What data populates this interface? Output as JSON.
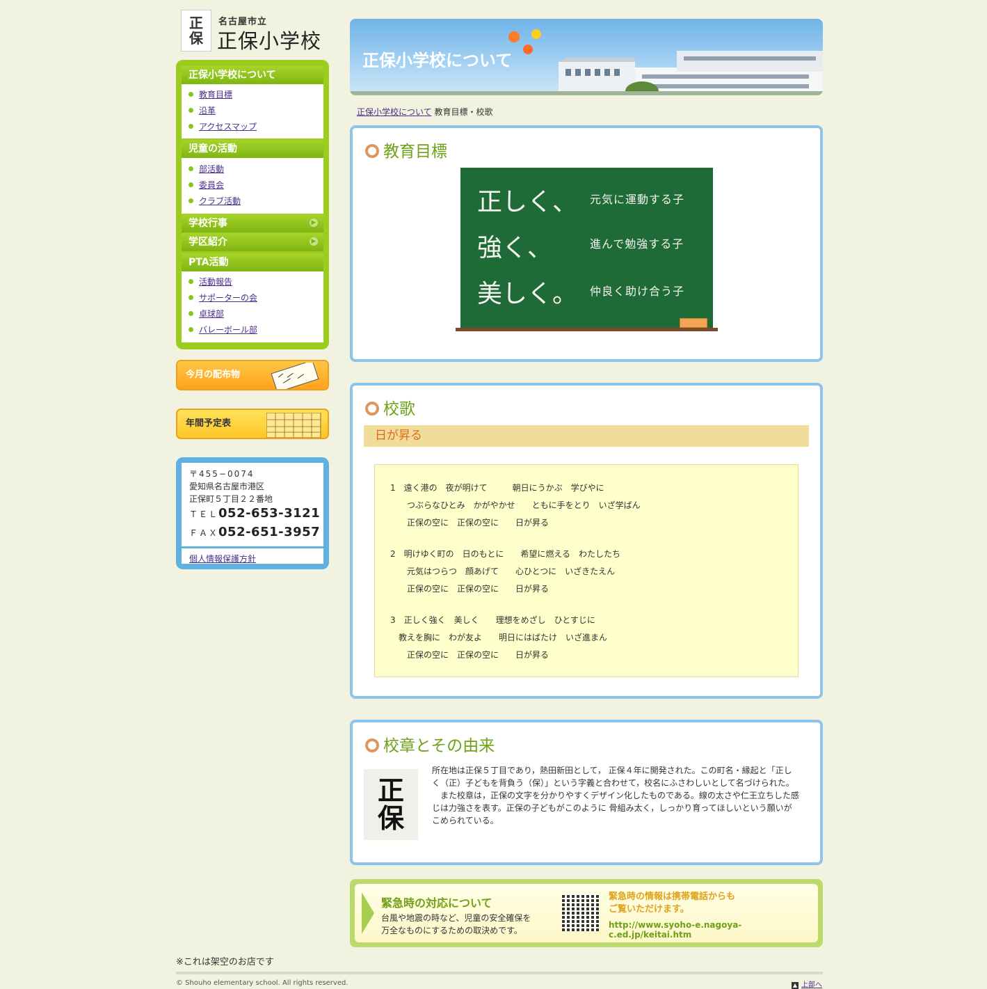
{
  "logo": {
    "mark_top": "正",
    "mark_bottom": "保",
    "sub": "名古屋市立",
    "name": "正保小学校"
  },
  "sidebar": {
    "sections": [
      {
        "title": "正保小学校について",
        "items": [
          "教育目標",
          "沿革",
          "アクセスマップ"
        ]
      },
      {
        "title": "児童の活動",
        "items": [
          "部活動",
          "委員会",
          "クラブ活動"
        ]
      },
      {
        "title": "学校行事"
      },
      {
        "title": "学区紹介"
      },
      {
        "title": "PTA活動",
        "items": [
          "活動報告",
          "サポーターの会",
          "卓球部",
          "バレーボール部"
        ]
      }
    ],
    "expand_icon": "chevron-right-circle-icon"
  },
  "banners": {
    "monthly": "今月の配布物",
    "annual": "年間予定表"
  },
  "address": {
    "postal": "〒455−0074",
    "line1": "愛知県名古屋市港区",
    "line2": "正保町５丁目２２番地",
    "tel_label": "ＴＥＬ",
    "tel": "052-653-3121",
    "fax_label": "ＦＡＸ",
    "fax": "052-651-3957",
    "privacy": "個人情報保護方針"
  },
  "header": {
    "title": "正保小学校について"
  },
  "breadcrumb": {
    "parent": "正保小学校について",
    "current": "教育目標・校歌"
  },
  "goals": {
    "title": "教育目標",
    "board": [
      {
        "left": "正しく、",
        "right": "元気に運動する子"
      },
      {
        "left": "強く、",
        "right": "進んで勉強する子"
      },
      {
        "left": "美しく。",
        "right": "仲良く助け合う子"
      }
    ]
  },
  "song": {
    "title": "校歌",
    "name": "日が昇る",
    "lines": [
      "1　遠く港の　夜が明けて　　　朝日にうかぶ　学びやに",
      "　　つぶらなひとみ　かがやかせ　　ともに手をとり　いざ学ばん",
      "　　正保の空に　正保の空に　　日が昇る",
      "2　明けゆく町の　日のもとに　　希望に燃える　わたしたち",
      "　　元気はつらつ　顔あげて　　心ひとつに　いざきたえん",
      "　　正保の空に　正保の空に　　日が昇る",
      "3　正しく強く　美しく　　理想をめざし　ひとすじに",
      "　教えを胸に　わが友よ　　明日にはばたけ　いざ進まん",
      "　　正保の空に　正保の空に　　日が昇る"
    ]
  },
  "crest": {
    "title": "校章とその由来",
    "top": "正",
    "bottom": "保",
    "text1": "所在地は正保５丁目であり，熱田新田として， 正保４年に開発された。この町名・縁起と「正しく（正）子どもを背負う（保）」という字義と合わせて，校名にふさわしいとして名づけられた。",
    "text2": "　また校章は，正保の文字を分かりやすくデザイン化したものである。線の太さや仁王立ちした感じは力強さを表す。正保の子どもがこのように 骨組み太く，しっかり育ってほしいという願いがこめられている。"
  },
  "emergency": {
    "title": "緊急時の対応について",
    "desc1": "台風や地震の時など、児童の安全確保を",
    "desc2": "万全なものにするための取決めです。",
    "qr_line1": "緊急時の情報は携帯電話からも",
    "qr_line2": "ご覧いただけます。",
    "url": "http://www.syoho-e.nagoya-c.ed.jp/keitai.htm"
  },
  "note": "※これは架空のお店です",
  "footer": {
    "copyright": "© Shouho elementary school. All rights reserved.",
    "totop": "上部へ"
  }
}
